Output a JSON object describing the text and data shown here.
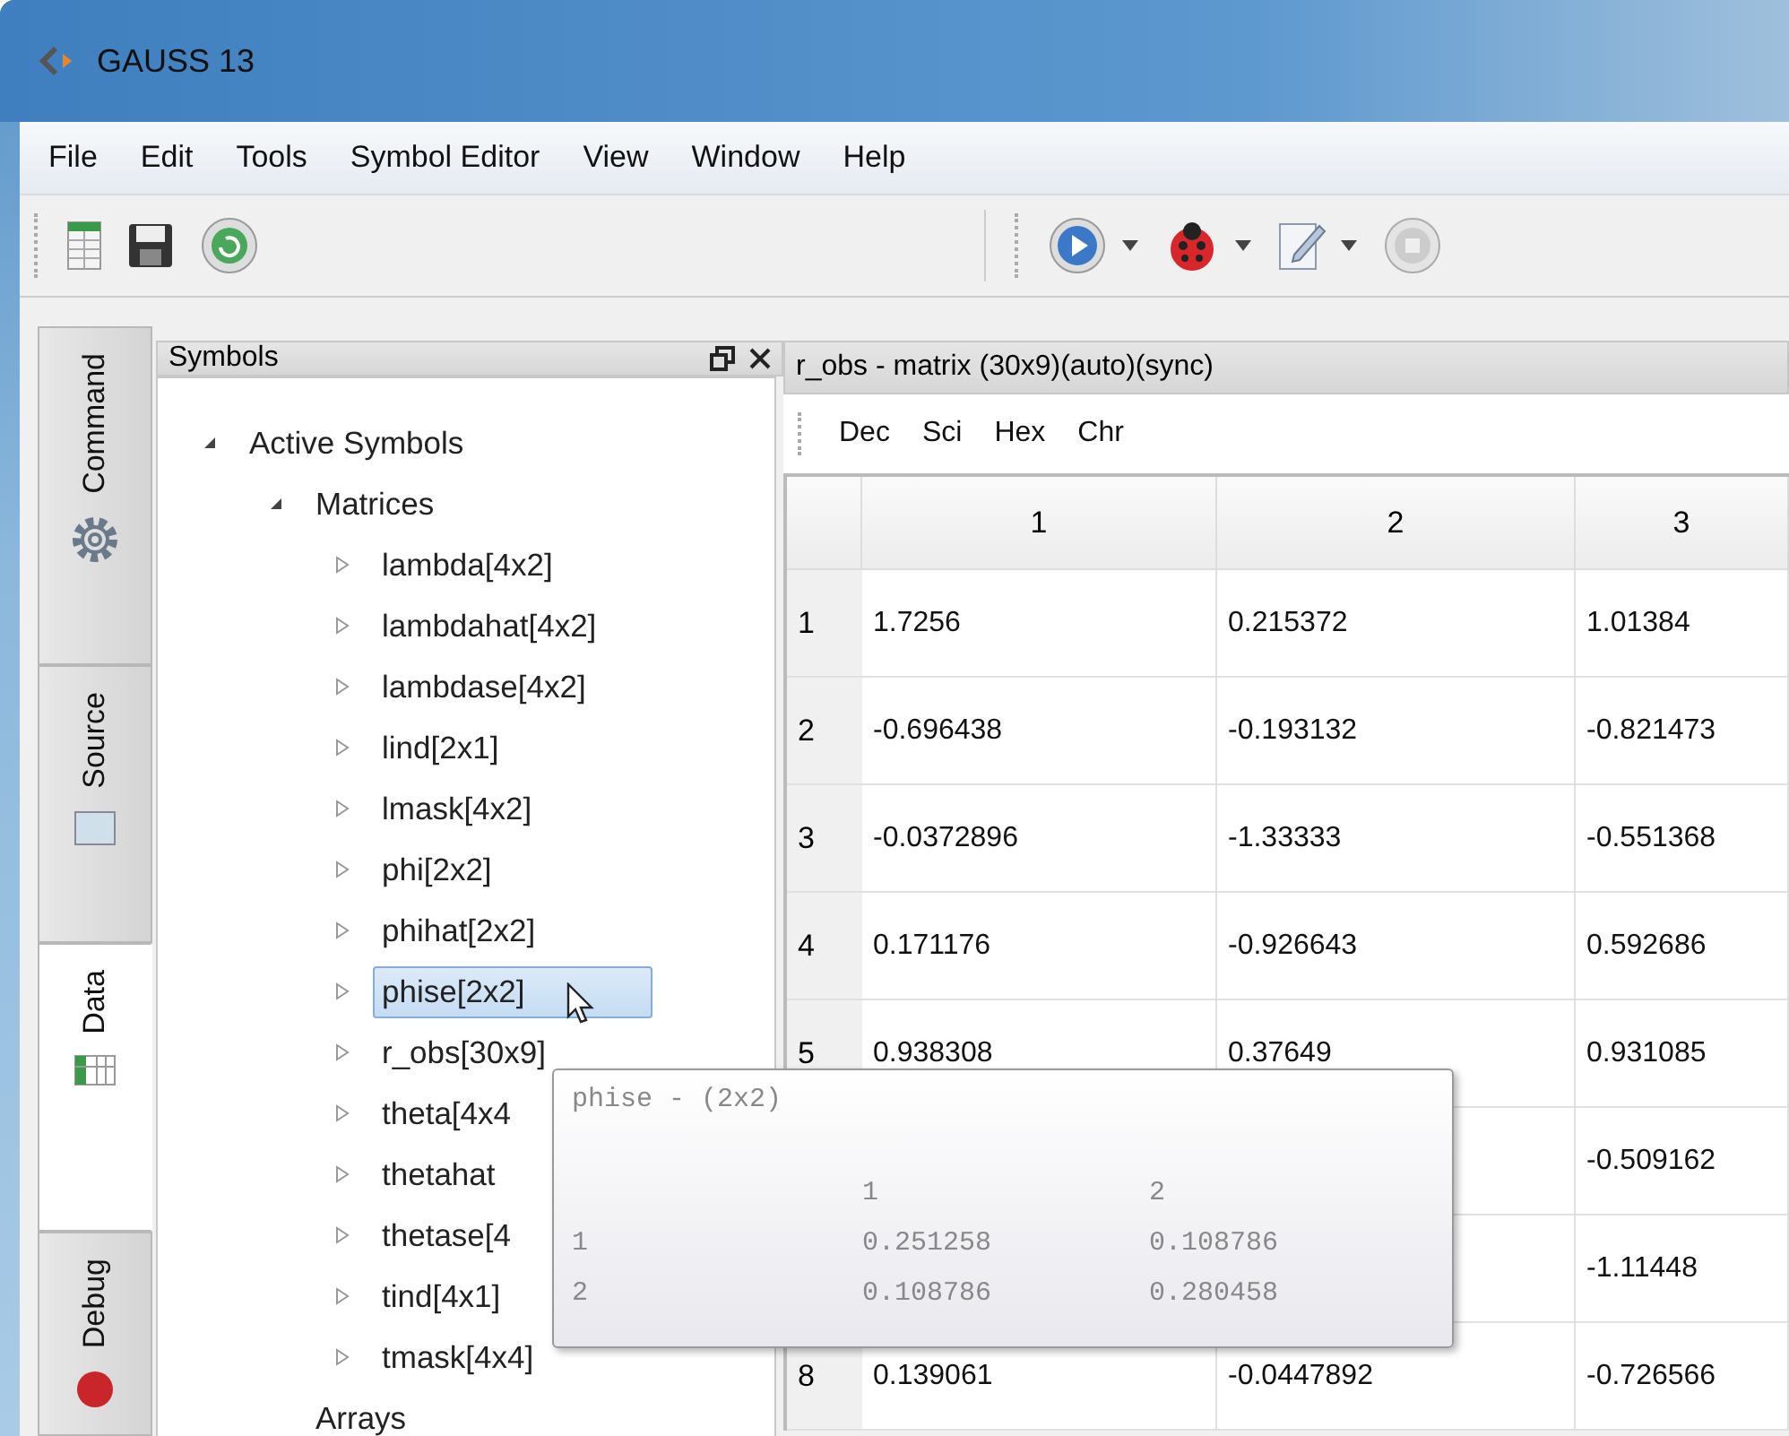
{
  "window": {
    "title": "GAUSS 13"
  },
  "menu": [
    "File",
    "Edit",
    "Tools",
    "Symbol Editor",
    "View",
    "Window",
    "Help"
  ],
  "side_tabs": [
    {
      "label": "Command",
      "kind": "command",
      "selected": false
    },
    {
      "label": "Source",
      "kind": "source",
      "selected": false
    },
    {
      "label": "Data",
      "kind": "data",
      "selected": true
    },
    {
      "label": "Debug",
      "kind": "debug",
      "selected": false
    }
  ],
  "symbols_panel": {
    "title": "Symbols",
    "tree": [
      {
        "label": "Active Symbols",
        "expandable": true,
        "expanded": true,
        "selected": false,
        "children": [
          {
            "label": "Matrices",
            "expandable": true,
            "expanded": true,
            "selected": false,
            "children": [
              {
                "label": "lambda[4x2]",
                "expandable": true,
                "expanded": false,
                "selected": false
              },
              {
                "label": "lambdahat[4x2]",
                "expandable": true,
                "expanded": false,
                "selected": false
              },
              {
                "label": "lambdase[4x2]",
                "expandable": true,
                "expanded": false,
                "selected": false
              },
              {
                "label": "lind[2x1]",
                "expandable": true,
                "expanded": false,
                "selected": false
              },
              {
                "label": "lmask[4x2]",
                "expandable": true,
                "expanded": false,
                "selected": false
              },
              {
                "label": "phi[2x2]",
                "expandable": true,
                "expanded": false,
                "selected": false
              },
              {
                "label": "phihat[2x2]",
                "expandable": true,
                "expanded": false,
                "selected": false
              },
              {
                "label": "phise[2x2]",
                "expandable": true,
                "expanded": false,
                "selected": true
              },
              {
                "label": "r_obs[30x9]",
                "expandable": true,
                "expanded": false,
                "selected": false
              },
              {
                "label": "theta[4x4",
                "expandable": true,
                "expanded": false,
                "selected": false
              },
              {
                "label": "thetahat",
                "expandable": true,
                "expanded": false,
                "selected": false
              },
              {
                "label": "thetase[4",
                "expandable": true,
                "expanded": false,
                "selected": false
              },
              {
                "label": "tind[4x1]",
                "expandable": true,
                "expanded": false,
                "selected": false
              },
              {
                "label": "tmask[4x4]",
                "expandable": true,
                "expanded": false,
                "selected": false
              }
            ]
          },
          {
            "label": "Arrays",
            "expandable": false,
            "expanded": false,
            "selected": false
          }
        ]
      }
    ]
  },
  "matrix_panel": {
    "title": "r_obs - matrix (30x9)(auto)(sync)",
    "formats": [
      "Dec",
      "Sci",
      "Hex",
      "Chr"
    ],
    "table": {
      "columns": [
        "1",
        "2",
        "3"
      ],
      "rows": [
        {
          "header": "1",
          "cells": [
            "1.7256",
            "0.215372",
            "1.01384"
          ]
        },
        {
          "header": "2",
          "cells": [
            "-0.696438",
            "-0.193132",
            "-0.821473"
          ]
        },
        {
          "header": "3",
          "cells": [
            "-0.0372896",
            "-1.33333",
            "-0.551368"
          ]
        },
        {
          "header": "4",
          "cells": [
            "0.171176",
            "-0.926643",
            "0.592686"
          ]
        },
        {
          "header": "5",
          "cells": [
            "0.938308",
            "0.37649",
            "0.931085"
          ]
        },
        {
          "header": null,
          "cells": [
            null,
            null,
            "-0.509162"
          ]
        },
        {
          "header": null,
          "cells": [
            null,
            null,
            "-1.11448"
          ]
        },
        {
          "header": "8",
          "cells": [
            "0.139061",
            "-0.0447892",
            "-0.726566"
          ]
        }
      ]
    }
  },
  "tooltip": {
    "title": "phise - (2x2)",
    "columns": [
      "1",
      "2"
    ],
    "rows": [
      {
        "header": "1",
        "cells": [
          "0.251258",
          "0.108786"
        ]
      },
      {
        "header": "2",
        "cells": [
          "0.108786",
          "0.280458"
        ]
      }
    ]
  }
}
